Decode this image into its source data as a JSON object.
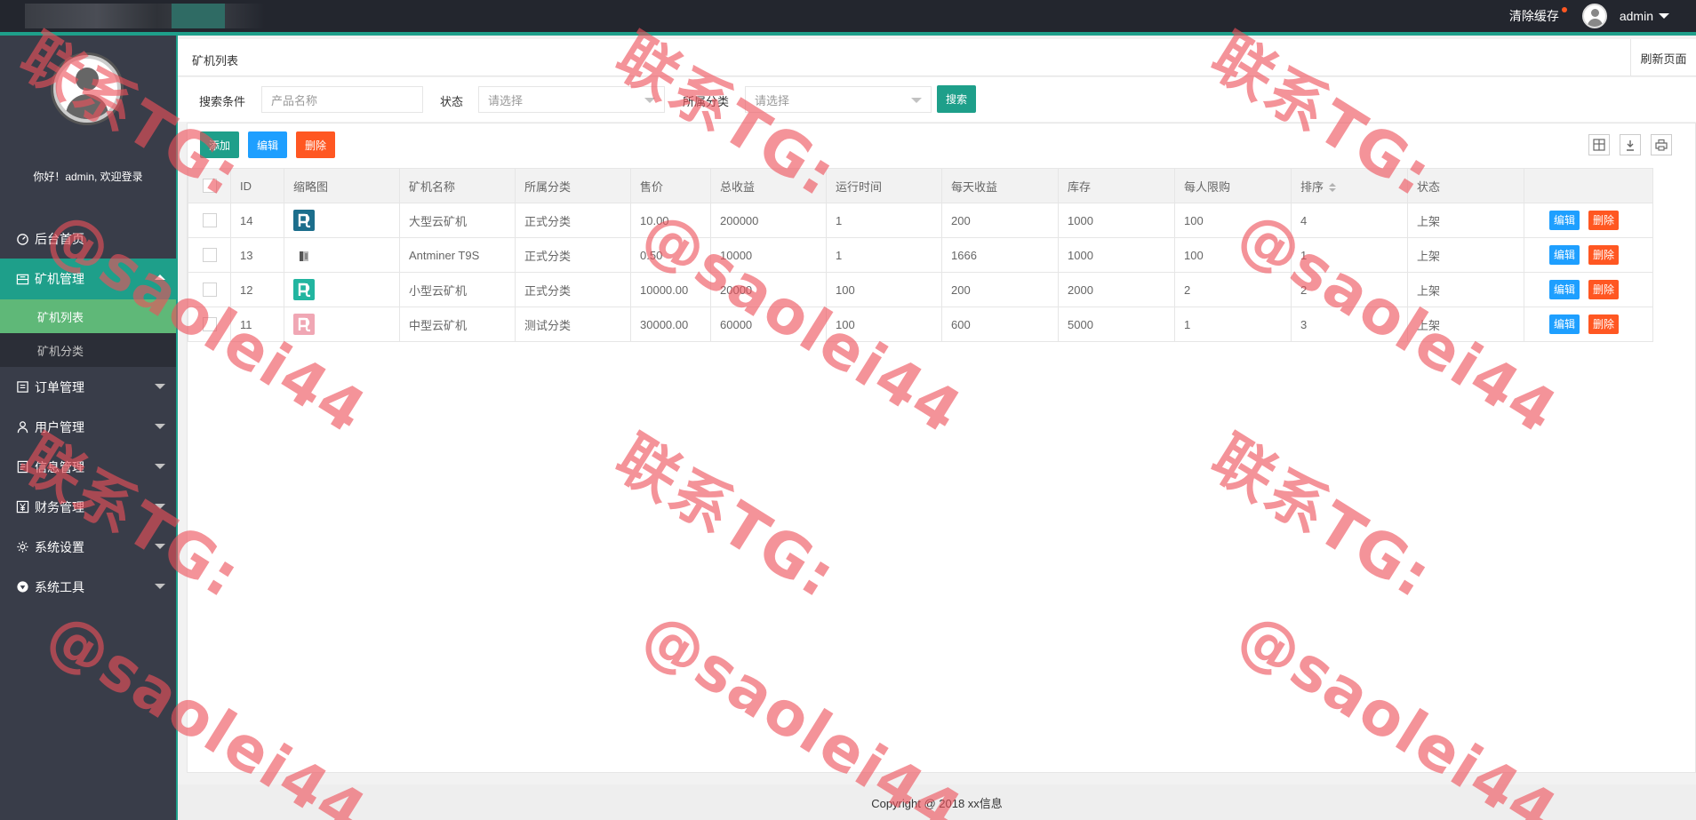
{
  "topbar": {
    "clear_cache": "清除缓存",
    "user": "admin"
  },
  "sidebar": {
    "welcome": "你好！admin, 欢迎登录",
    "items": [
      {
        "label": "后台首页",
        "icon": "dashboard-icon"
      },
      {
        "label": "矿机管理",
        "icon": "panel-icon"
      },
      {
        "label": "订单管理",
        "icon": "list-icon"
      },
      {
        "label": "用户管理",
        "icon": "user-icon"
      },
      {
        "label": "信息管理",
        "icon": "document-icon"
      },
      {
        "label": "财务管理",
        "icon": "yen-icon"
      },
      {
        "label": "系统设置",
        "icon": "gear-icon"
      },
      {
        "label": "系统工具",
        "icon": "diamond-icon"
      }
    ],
    "sub_items": [
      {
        "label": "矿机列表"
      },
      {
        "label": "矿机分类"
      }
    ]
  },
  "tab": {
    "title": "矿机列表",
    "refresh": "刷新页面"
  },
  "search": {
    "condition_label": "搜索条件",
    "name_placeholder": "产品名称",
    "status_label": "状态",
    "status_placeholder": "请选择",
    "category_label": "所属分类",
    "category_placeholder": "请选择",
    "search_button": "搜索"
  },
  "toolbar": {
    "add": "添加",
    "edit": "编辑",
    "delete": "删除"
  },
  "table": {
    "headers": [
      "ID",
      "缩略图",
      "矿机名称",
      "所属分类",
      "售价",
      "总收益",
      "运行时间",
      "每天收益",
      "库存",
      "每人限购",
      "排序",
      "状态"
    ],
    "rows": [
      {
        "id": "14",
        "thumb": "teal-dark",
        "name": "大型云矿机",
        "category": "正式分类",
        "price": "10.00",
        "total": "200000",
        "runtime": "1",
        "daily": "200",
        "stock": "1000",
        "limit": "100",
        "sort": "4",
        "status": "上架"
      },
      {
        "id": "13",
        "thumb": "device",
        "name": "Antminer T9S",
        "category": "正式分类",
        "price": "0.50",
        "total": "10000",
        "runtime": "1",
        "daily": "1666",
        "stock": "1000",
        "limit": "100",
        "sort": "1",
        "status": "上架"
      },
      {
        "id": "12",
        "thumb": "teal",
        "name": "小型云矿机",
        "category": "正式分类",
        "price": "10000.00",
        "total": "20000",
        "runtime": "100",
        "daily": "200",
        "stock": "2000",
        "limit": "2",
        "sort": "2",
        "status": "上架"
      },
      {
        "id": "11",
        "thumb": "pink",
        "name": "中型云矿机",
        "category": "测试分类",
        "price": "30000.00",
        "total": "60000",
        "runtime": "100",
        "daily": "600",
        "stock": "5000",
        "limit": "1",
        "sort": "3",
        "status": "上架"
      }
    ],
    "row_edit": "编辑",
    "row_delete": "删除"
  },
  "footer": {
    "copyright": "Copyright @ 2018 xx信息"
  },
  "watermark": {
    "line1": "联系TG:",
    "line2": "@saolei44"
  },
  "colors": {
    "topbar": "#23262e",
    "sidebar": "#393d49",
    "accent": "#1e9f8a",
    "sub_active": "#5fb878",
    "blue": "#1e9fff",
    "orange": "#ff5722"
  }
}
